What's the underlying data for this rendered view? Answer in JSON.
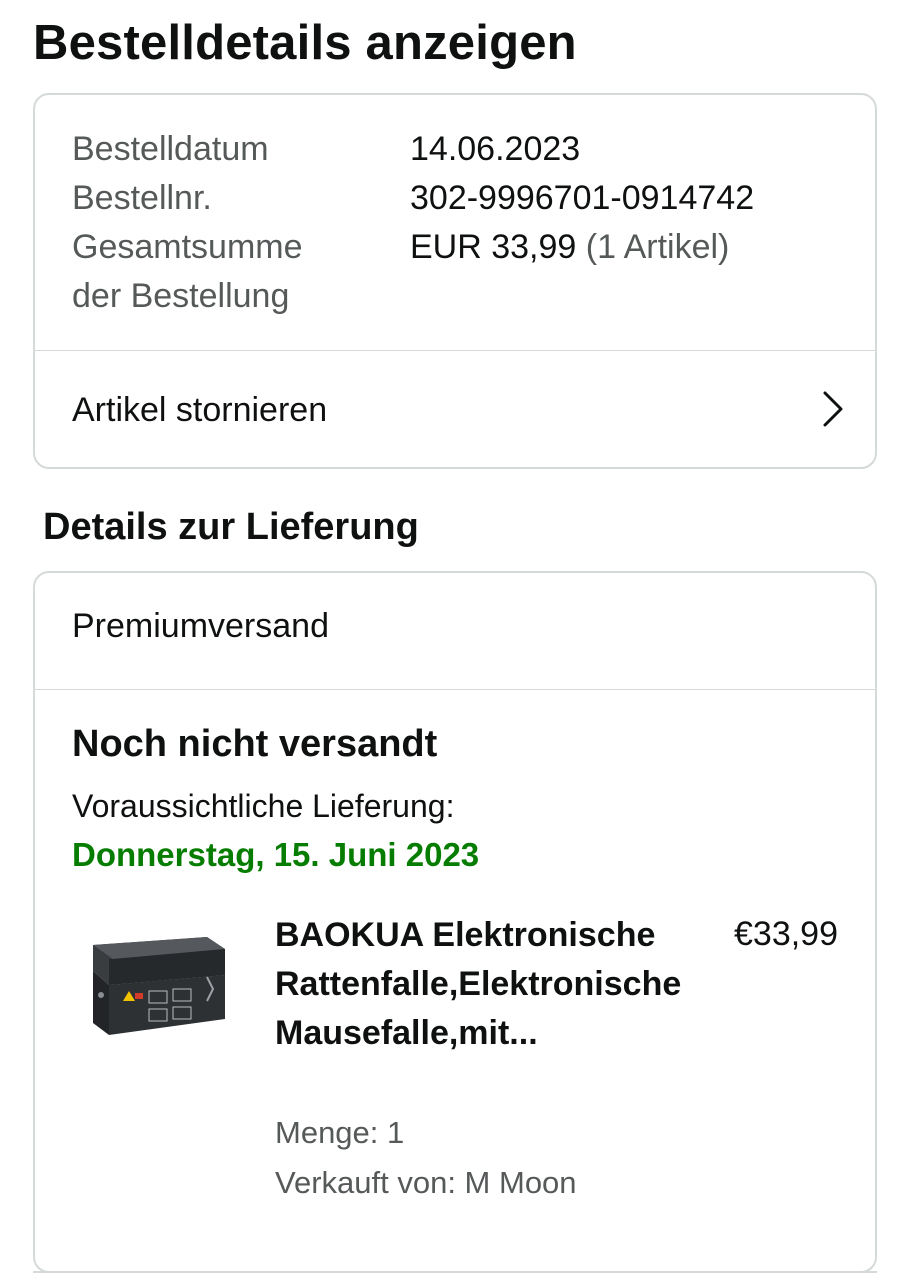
{
  "header": {
    "title": "Bestelldetails anzeigen"
  },
  "summary": {
    "rows": [
      {
        "label": "Bestelldatum",
        "value": "14.06.2023"
      },
      {
        "label": "Bestellnr.",
        "value": "302-9996701-0914742"
      },
      {
        "label_line1": "Gesamtsumme",
        "label_line2": "der Bestellung",
        "value": "EUR 33,99",
        "value_suffix": "(1 Artikel)"
      }
    ],
    "cancel_label": "Artikel stornieren",
    "cancel_icon": "chevron-right-icon"
  },
  "delivery": {
    "section_title": "Details zur Lieferung",
    "shipping_method": "Premiumversand",
    "status": "Noch nicht versandt",
    "eta_label": "Voraussichtliche Lieferung:",
    "eta_date": "Donnerstag, 15. Juni 2023",
    "eta_color": "#067d00",
    "item": {
      "title": "BAOKUA Elektronische Rattenfalle,Elektronische Mausefalle,mit...",
      "price": "€33,99",
      "quantity": "Menge: 1",
      "seller": "Verkauft von: M Moon"
    }
  }
}
